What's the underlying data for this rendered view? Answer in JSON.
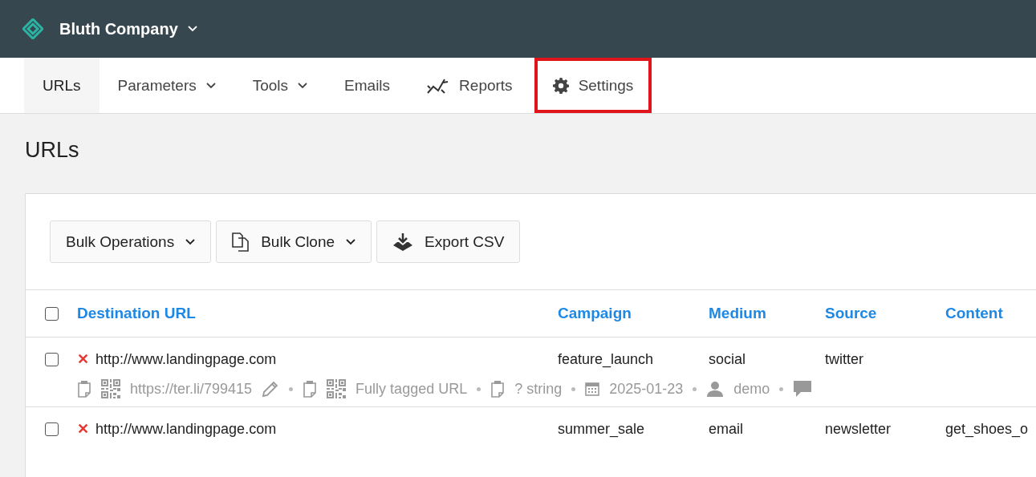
{
  "header": {
    "company": "Bluth Company"
  },
  "nav": [
    {
      "label": "URLs",
      "selected": true,
      "dropdown": false,
      "highlighted": false
    },
    {
      "label": "Parameters",
      "selected": false,
      "dropdown": true,
      "highlighted": false
    },
    {
      "label": "Tools",
      "selected": false,
      "dropdown": true,
      "highlighted": false
    },
    {
      "label": "Emails",
      "selected": false,
      "dropdown": false,
      "highlighted": false
    },
    {
      "label": "Reports",
      "selected": false,
      "dropdown": false,
      "highlighted": false
    },
    {
      "label": "Settings",
      "selected": false,
      "dropdown": false,
      "highlighted": true
    }
  ],
  "page_title": "URLs",
  "toolbar": [
    {
      "label": "Bulk Operations",
      "dropdown": true
    },
    {
      "label": "Bulk Clone",
      "dropdown": true
    },
    {
      "label": "Export CSV",
      "dropdown": false
    }
  ],
  "table": {
    "select_all": {
      "checked": false
    },
    "columns": [
      "Destination URL",
      "Campaign",
      "Medium",
      "Source",
      "Content"
    ],
    "rows": [
      {
        "checked": false,
        "remove": "✕",
        "cells": [
          "http://www.landingpage.com",
          "feature_launch",
          "social",
          "twitter",
          ""
        ],
        "meta": [
          {
            "kind": "copy"
          },
          {
            "kind": "qr"
          },
          {
            "kind": "text",
            "text": "https://ter.li/799415"
          },
          {
            "kind": "edit"
          },
          {
            "kind": "sep"
          },
          {
            "kind": "copy"
          },
          {
            "kind": "qr"
          },
          {
            "kind": "text",
            "text": "Fully tagged URL"
          },
          {
            "kind": "sep"
          },
          {
            "kind": "copy"
          },
          {
            "kind": "text",
            "text": "? string"
          },
          {
            "kind": "sep"
          },
          {
            "kind": "date"
          },
          {
            "kind": "text",
            "text": "2025-01-23"
          },
          {
            "kind": "sep"
          },
          {
            "kind": "user"
          },
          {
            "kind": "text",
            "text": "demo"
          },
          {
            "kind": "sep"
          },
          {
            "kind": "comment"
          }
        ]
      },
      {
        "checked": false,
        "remove": "✕",
        "cells": [
          "http://www.landingpage.com",
          "summer_sale",
          "email",
          "newsletter",
          "get_shoes_o"
        ],
        "meta": []
      }
    ]
  }
}
